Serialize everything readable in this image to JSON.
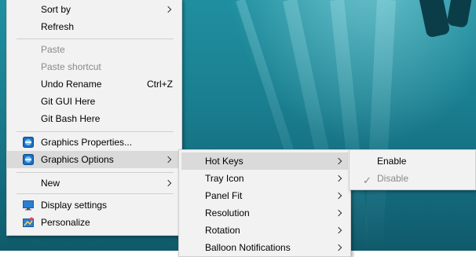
{
  "context_menu": {
    "items": [
      {
        "label": "Sort by",
        "submenu": true
      },
      {
        "label": "Refresh"
      },
      {
        "label": "Paste",
        "disabled": true
      },
      {
        "label": "Paste shortcut",
        "disabled": true
      },
      {
        "label": "Undo Rename",
        "shortcut": "Ctrl+Z"
      },
      {
        "label": "Git GUI Here"
      },
      {
        "label": "Git Bash Here"
      },
      {
        "label": "Graphics Properties...",
        "icon": "intel-graphics-icon"
      },
      {
        "label": "Graphics Options",
        "icon": "intel-graphics-icon",
        "submenu": true,
        "highlighted": true
      },
      {
        "label": "New",
        "submenu": true
      },
      {
        "label": "Display settings",
        "icon": "display-icon"
      },
      {
        "label": "Personalize",
        "icon": "personalize-icon"
      }
    ]
  },
  "graphics_options_menu": {
    "items": [
      {
        "label": "Hot Keys",
        "submenu": true,
        "highlighted": true
      },
      {
        "label": "Tray Icon",
        "submenu": true
      },
      {
        "label": "Panel Fit",
        "submenu": true
      },
      {
        "label": "Resolution",
        "submenu": true
      },
      {
        "label": "Rotation",
        "submenu": true
      },
      {
        "label": "Balloon Notifications",
        "submenu": true
      }
    ]
  },
  "hot_keys_menu": {
    "items": [
      {
        "label": "Enable"
      },
      {
        "label": "Disable",
        "checked": true,
        "disabled": true
      }
    ]
  },
  "colors": {
    "menu_bg": "#f2f2f2",
    "highlight": "#dadada",
    "disabled_text": "#8a8a8a",
    "desktop_teal": "#1a7f90"
  }
}
